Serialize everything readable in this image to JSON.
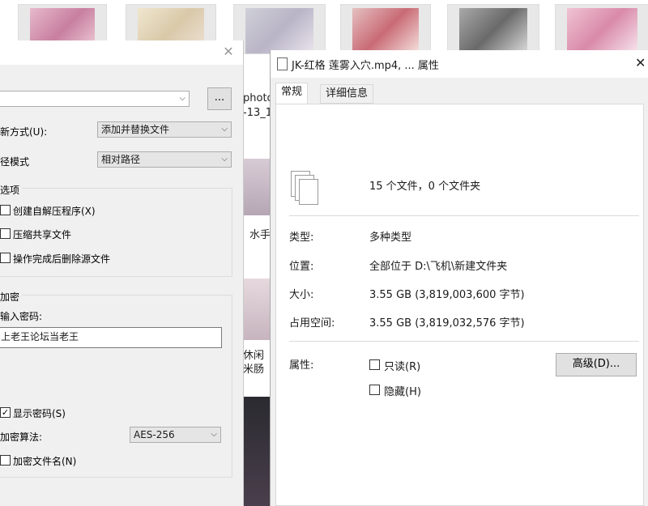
{
  "background": {
    "bg_labels": [
      "photo",
      "-13_1",
      "水手",
      "休闲",
      "米肠"
    ]
  },
  "zip_dialog": {
    "update_mode_label": "新方式(U):",
    "update_mode_value": "添加并替换文件",
    "path_mode_label": "径模式",
    "path_mode_value": "相对路径",
    "browse_label": "...",
    "options_title": "选项",
    "options": [
      {
        "label": "创建自解压程序(X)",
        "checked": false
      },
      {
        "label": "压缩共享文件",
        "checked": false
      },
      {
        "label": "操作完成后删除源文件",
        "checked": false
      }
    ],
    "encryption_title": "加密",
    "password_label": "输入密码:",
    "password_value": "上老王论坛当老王",
    "show_password_label": "显示密码(S)",
    "show_password_checked": true,
    "algorithm_label": "加密算法:",
    "algorithm_value": "AES-256",
    "encrypt_names_label": "加密文件名(N)",
    "encrypt_names_checked": false
  },
  "properties": {
    "title": "JK-红格 莲雾入穴.mp4, ... 属性",
    "tabs": [
      {
        "label": "常规",
        "active": true
      },
      {
        "label": "详细信息",
        "active": false
      }
    ],
    "summary": "15 个文件，0 个文件夹",
    "type_label": "类型:",
    "type_value": "多种类型",
    "location_label": "位置:",
    "location_value": "全部位于 D:\\飞机\\新建文件夹",
    "size_label": "大小:",
    "size_value": "3.55 GB (3,819,003,600 字节)",
    "disk_label": "占用空间:",
    "disk_value": "3.55 GB (3,819,032,576 字节)",
    "attributes_label": "属性:",
    "readonly_label": "只读(R)",
    "hidden_label": "隐藏(H)",
    "advanced_label": "高级(D)..."
  }
}
